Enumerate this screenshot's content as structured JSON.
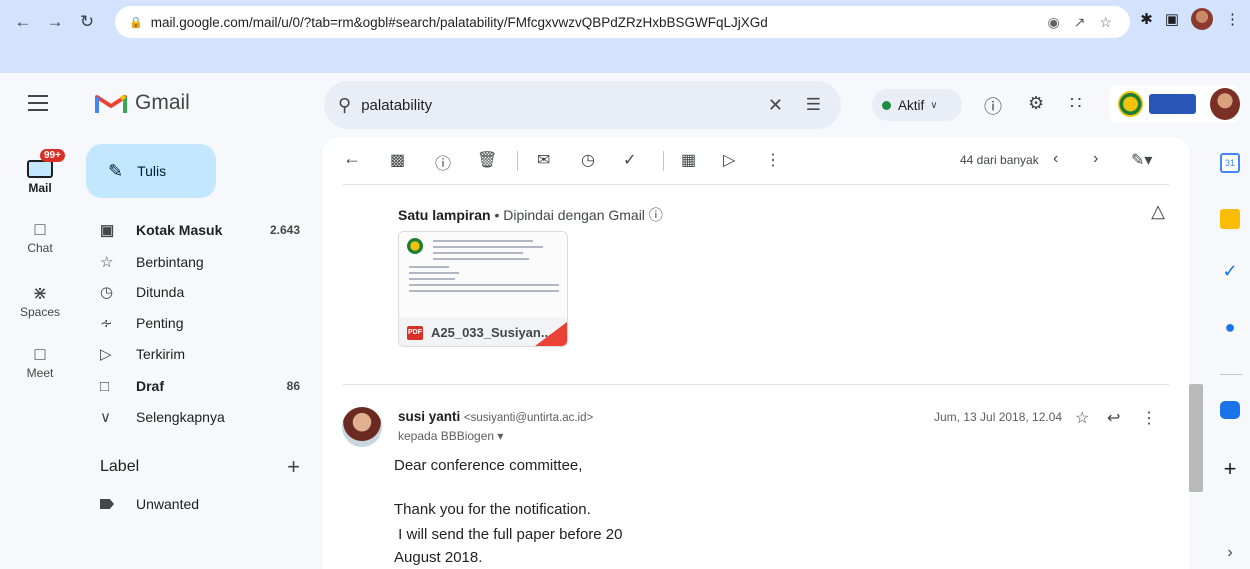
{
  "browser": {
    "url": "mail.google.com/mail/u/0/?tab=rm&ogbl#search/palatability/FMfcgxvwzvQBPdZRzHxbBSGWFqLJjXGd"
  },
  "header": {
    "app_name": "Gmail",
    "search_value": "palatability",
    "status_label": "Aktif"
  },
  "rail": {
    "badge": "99+",
    "items": [
      "Mail",
      "Chat",
      "Spaces",
      "Meet"
    ]
  },
  "nav": {
    "compose_label": "Tulis",
    "items": [
      {
        "label": "Kotak Masuk",
        "count": "2.643"
      },
      {
        "label": "Berbintang",
        "count": ""
      },
      {
        "label": "Ditunda",
        "count": ""
      },
      {
        "label": "Penting",
        "count": ""
      },
      {
        "label": "Terkirim",
        "count": ""
      },
      {
        "label": "Draf",
        "count": "86"
      },
      {
        "label": "Selengkapnya",
        "count": ""
      }
    ],
    "labels_heading": "Label",
    "labels": [
      "Unwanted"
    ]
  },
  "toolbar": {
    "count_text": "44 dari banyak"
  },
  "attachment": {
    "title": "Satu lampiran",
    "scan_note": "Dipindai dengan Gmail",
    "filename": "A25_033_Susiyan..."
  },
  "message": {
    "sender_name": "susi yanti",
    "sender_email": "<susiyanti@untirta.ac.id>",
    "recipient": "kepada BBBiogen",
    "date": "Jum, 13 Jul 2018, 12.04",
    "body": [
      "Dear conference committee,",
      "Thank you for the notification.",
      " I will send the full paper before 20",
      "August 2018."
    ]
  },
  "colors": {
    "compose_bg": "#c2e7ff",
    "status_green": "#1e8e3e",
    "badge_red": "#d93025"
  }
}
